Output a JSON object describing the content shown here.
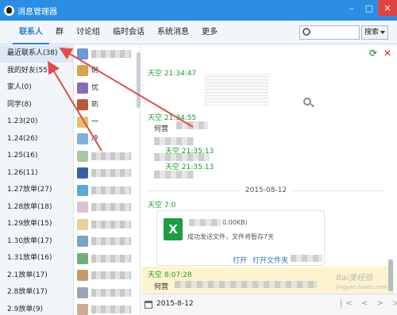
{
  "window": {
    "title": "消息管理器"
  },
  "nav": {
    "tabs": [
      "联系人",
      "群",
      "讨论组",
      "临时会话",
      "系统消息",
      "更多"
    ],
    "active_tab": "联系人",
    "search_placeholder": "",
    "search_button": "搜索"
  },
  "sidebar": {
    "groups": [
      "最近联系人(38)",
      "我的好友(55)",
      "家人(0)",
      "同学(8)",
      "1.23(20)",
      "1.24(26)",
      "1.25(16)",
      "1.26(11)",
      "1.27放单(27)",
      "1.28放单(18)",
      "1.29放单(15)",
      "1.30放单(17)",
      "1.31放单(16)",
      "2.1放单(17)",
      "2.8放单(17)",
      "2.9放单(9)"
    ],
    "active_index": 0
  },
  "friends": {
    "visible_names": [
      "",
      "俐",
      "优",
      "凯",
      "一",
      "冷",
      "",
      "",
      "",
      "",
      "",
      "",
      "",
      "",
      "",
      ""
    ]
  },
  "chat": {
    "messages": [
      {
        "header": "天空 21:34:47",
        "text": ""
      },
      {
        "header": "天空 21:34:55",
        "text": "何营"
      },
      {
        "header": "天空 21:35:13",
        "text": ""
      },
      {
        "header": "天空 21:35:13",
        "text": ""
      }
    ],
    "date_separator": "2015-08-12",
    "file_message_header": "天空 7:0",
    "file": {
      "size": "0.00KB)",
      "status": "成功发送文件，文件将暂存7天",
      "open": "打开",
      "open_folder": "打开文件夹"
    },
    "highlight_header": "天空 8:07:28",
    "highlight_text": "何营",
    "watermark": "Bai度经验",
    "watermark_sub": "jingyan.baidu.com"
  },
  "footer": {
    "date": "2015-8-12"
  },
  "colors": {
    "accent": "#2b8ee3",
    "green": "#1d9a2e",
    "highlight_bg": "#fdf4cf",
    "arrow": "#e34b4b"
  }
}
